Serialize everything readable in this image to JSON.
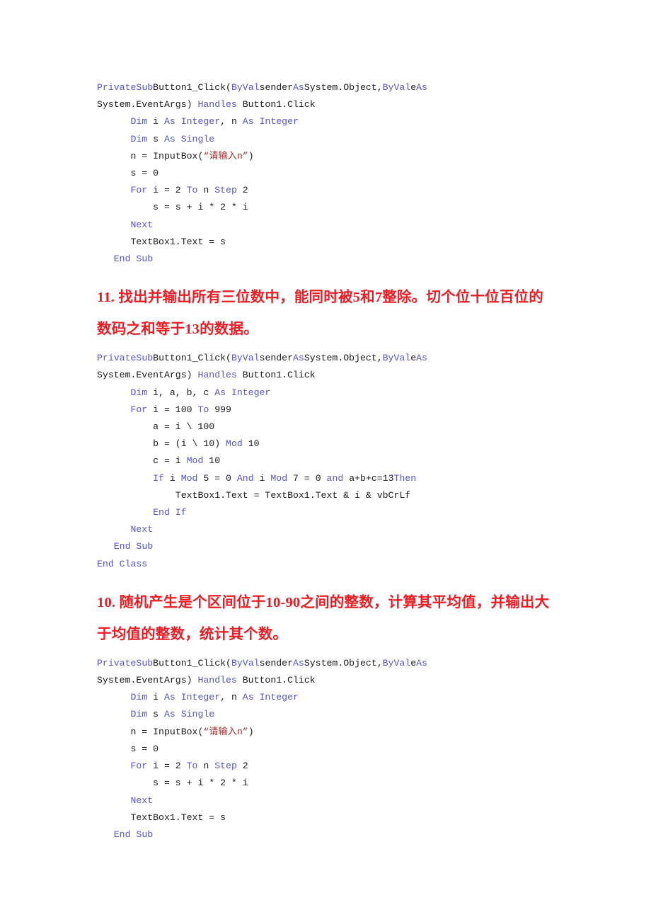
{
  "document": {
    "language": "Visual Basic .NET",
    "page_background": "#ffffff",
    "colors": {
      "keyword": "#5555c8",
      "string": "#a33232",
      "heading": "#ec1c24",
      "body_text": "#1a1a1a"
    }
  },
  "blocks": [
    {
      "type": "code",
      "id": "code-block-1",
      "lines": [
        {
          "justified": true,
          "tokens": [
            {
              "t": "Private",
              "c": "kw"
            },
            {
              "t": "Sub",
              "c": "kw"
            },
            {
              "t": "Button1_Click(",
              "c": "plain"
            },
            {
              "t": "ByVal",
              "c": "kw"
            },
            {
              "t": "sender",
              "c": "plain"
            },
            {
              "t": "As",
              "c": "kw"
            },
            {
              "t": "System.Object,",
              "c": "plain"
            },
            {
              "t": "ByVal",
              "c": "kw"
            },
            {
              "t": "e",
              "c": "plain"
            },
            {
              "t": "As",
              "c": "kw"
            }
          ]
        },
        {
          "justified": false,
          "tokens": [
            {
              "t": "System.EventArgs) ",
              "c": "plain"
            },
            {
              "t": "Handles",
              "c": "kw"
            },
            {
              "t": " Button1.Click",
              "c": "plain"
            }
          ]
        },
        {
          "justified": false,
          "tokens": [
            {
              "t": "      ",
              "c": "plain"
            },
            {
              "t": "Dim",
              "c": "kw"
            },
            {
              "t": " i ",
              "c": "plain"
            },
            {
              "t": "As Integer",
              "c": "kw"
            },
            {
              "t": ", n ",
              "c": "plain"
            },
            {
              "t": "As Integer",
              "c": "kw"
            }
          ]
        },
        {
          "justified": false,
          "tokens": [
            {
              "t": "      ",
              "c": "plain"
            },
            {
              "t": "Dim",
              "c": "kw"
            },
            {
              "t": " s ",
              "c": "plain"
            },
            {
              "t": "As Single",
              "c": "kw"
            }
          ]
        },
        {
          "justified": false,
          "tokens": [
            {
              "t": "      n = InputBox(",
              "c": "plain"
            },
            {
              "t": "“请输入n”",
              "c": "str"
            },
            {
              "t": ")",
              "c": "plain"
            }
          ]
        },
        {
          "justified": false,
          "tokens": [
            {
              "t": "      s = 0",
              "c": "plain"
            }
          ]
        },
        {
          "justified": false,
          "tokens": [
            {
              "t": "      ",
              "c": "plain"
            },
            {
              "t": "For",
              "c": "kw"
            },
            {
              "t": " i = 2 ",
              "c": "plain"
            },
            {
              "t": "To",
              "c": "kw"
            },
            {
              "t": " n ",
              "c": "plain"
            },
            {
              "t": "Step",
              "c": "kw"
            },
            {
              "t": " 2",
              "c": "plain"
            }
          ]
        },
        {
          "justified": false,
          "tokens": [
            {
              "t": "          s = s + i * 2 * i",
              "c": "plain"
            }
          ]
        },
        {
          "justified": false,
          "tokens": [
            {
              "t": "      ",
              "c": "plain"
            },
            {
              "t": "Next",
              "c": "kw"
            }
          ]
        },
        {
          "justified": false,
          "tokens": [
            {
              "t": "      TextBox1.Text = s",
              "c": "plain"
            }
          ]
        },
        {
          "justified": false,
          "tokens": [
            {
              "t": "   ",
              "c": "plain"
            },
            {
              "t": "End Sub",
              "c": "kw"
            }
          ]
        }
      ]
    },
    {
      "type": "heading",
      "id": "heading-11",
      "text": "11. 找出并输出所有三位数中，能同时被5和7整除。切个位十位百位的数码之和等于13的数据。"
    },
    {
      "type": "code",
      "id": "code-block-2",
      "lines": [
        {
          "justified": true,
          "tokens": [
            {
              "t": "Private",
              "c": "kw"
            },
            {
              "t": "Sub",
              "c": "kw"
            },
            {
              "t": "Button1_Click(",
              "c": "plain"
            },
            {
              "t": "ByVal",
              "c": "kw"
            },
            {
              "t": "sender",
              "c": "plain"
            },
            {
              "t": "As",
              "c": "kw"
            },
            {
              "t": "System.Object,",
              "c": "plain"
            },
            {
              "t": "ByVal",
              "c": "kw"
            },
            {
              "t": "e",
              "c": "plain"
            },
            {
              "t": "As",
              "c": "kw"
            }
          ]
        },
        {
          "justified": false,
          "tokens": [
            {
              "t": "System.EventArgs) ",
              "c": "plain"
            },
            {
              "t": "Handles",
              "c": "kw"
            },
            {
              "t": " Button1.Click",
              "c": "plain"
            }
          ]
        },
        {
          "justified": false,
          "tokens": [
            {
              "t": "      ",
              "c": "plain"
            },
            {
              "t": "Dim",
              "c": "kw"
            },
            {
              "t": " i, a, b, c ",
              "c": "plain"
            },
            {
              "t": "As Integer",
              "c": "kw"
            }
          ]
        },
        {
          "justified": false,
          "tokens": [
            {
              "t": "      ",
              "c": "plain"
            },
            {
              "t": "For",
              "c": "kw"
            },
            {
              "t": " i = 100 ",
              "c": "plain"
            },
            {
              "t": "To",
              "c": "kw"
            },
            {
              "t": " 999",
              "c": "plain"
            }
          ]
        },
        {
          "justified": false,
          "tokens": [
            {
              "t": "          a = i \\ 100",
              "c": "plain"
            }
          ]
        },
        {
          "justified": false,
          "tokens": [
            {
              "t": "          b = (i \\ 10) ",
              "c": "plain"
            },
            {
              "t": "Mod",
              "c": "kw"
            },
            {
              "t": " 10",
              "c": "plain"
            }
          ]
        },
        {
          "justified": false,
          "tokens": [
            {
              "t": "          c = i ",
              "c": "plain"
            },
            {
              "t": "Mod",
              "c": "kw"
            },
            {
              "t": " 10",
              "c": "plain"
            }
          ]
        },
        {
          "justified": false,
          "tokens": [
            {
              "t": "          ",
              "c": "plain"
            },
            {
              "t": "If",
              "c": "kw"
            },
            {
              "t": " i ",
              "c": "plain"
            },
            {
              "t": "Mod",
              "c": "kw"
            },
            {
              "t": " 5 = 0 ",
              "c": "plain"
            },
            {
              "t": "And",
              "c": "kw"
            },
            {
              "t": " i ",
              "c": "plain"
            },
            {
              "t": "Mod",
              "c": "kw"
            },
            {
              "t": " 7 = 0 ",
              "c": "plain"
            },
            {
              "t": "and",
              "c": "kw"
            },
            {
              "t": " a+b+c=13",
              "c": "plain"
            },
            {
              "t": "Then",
              "c": "kw"
            }
          ]
        },
        {
          "justified": false,
          "tokens": [
            {
              "t": "              TextBox1.Text = TextBox1.Text & i & vbCrLf",
              "c": "plain"
            }
          ]
        },
        {
          "justified": false,
          "tokens": [
            {
              "t": "          ",
              "c": "plain"
            },
            {
              "t": "End If",
              "c": "kw"
            }
          ]
        },
        {
          "justified": false,
          "tokens": [
            {
              "t": "      ",
              "c": "plain"
            },
            {
              "t": "Next",
              "c": "kw"
            }
          ]
        },
        {
          "justified": false,
          "tokens": [
            {
              "t": "   ",
              "c": "plain"
            },
            {
              "t": "End Sub",
              "c": "kw"
            }
          ]
        },
        {
          "justified": false,
          "tokens": [
            {
              "t": "End Class",
              "c": "kw"
            }
          ]
        }
      ]
    },
    {
      "type": "heading",
      "id": "heading-10",
      "text": "10. 随机产生是个区间位于10-90之间的整数，计算其平均值，并输出大于均值的整数，统计其个数。"
    },
    {
      "type": "code",
      "id": "code-block-3",
      "lines": [
        {
          "justified": true,
          "tokens": [
            {
              "t": "Private",
              "c": "kw"
            },
            {
              "t": "Sub",
              "c": "kw"
            },
            {
              "t": "Button1_Click(",
              "c": "plain"
            },
            {
              "t": "ByVal",
              "c": "kw"
            },
            {
              "t": "sender",
              "c": "plain"
            },
            {
              "t": "As",
              "c": "kw"
            },
            {
              "t": "System.Object,",
              "c": "plain"
            },
            {
              "t": "ByVal",
              "c": "kw"
            },
            {
              "t": "e",
              "c": "plain"
            },
            {
              "t": "As",
              "c": "kw"
            }
          ]
        },
        {
          "justified": false,
          "tokens": [
            {
              "t": "System.EventArgs) ",
              "c": "plain"
            },
            {
              "t": "Handles",
              "c": "kw"
            },
            {
              "t": " Button1.Click",
              "c": "plain"
            }
          ]
        },
        {
          "justified": false,
          "tokens": [
            {
              "t": "      ",
              "c": "plain"
            },
            {
              "t": "Dim",
              "c": "kw"
            },
            {
              "t": " i ",
              "c": "plain"
            },
            {
              "t": "As Integer",
              "c": "kw"
            },
            {
              "t": ", n ",
              "c": "plain"
            },
            {
              "t": "As Integer",
              "c": "kw"
            }
          ]
        },
        {
          "justified": false,
          "tokens": [
            {
              "t": "      ",
              "c": "plain"
            },
            {
              "t": "Dim",
              "c": "kw"
            },
            {
              "t": " s ",
              "c": "plain"
            },
            {
              "t": "As Single",
              "c": "kw"
            }
          ]
        },
        {
          "justified": false,
          "tokens": [
            {
              "t": "      n = InputBox(",
              "c": "plain"
            },
            {
              "t": "“请输入n”",
              "c": "str"
            },
            {
              "t": ")",
              "c": "plain"
            }
          ]
        },
        {
          "justified": false,
          "tokens": [
            {
              "t": "      s = 0",
              "c": "plain"
            }
          ]
        },
        {
          "justified": false,
          "tokens": [
            {
              "t": "      ",
              "c": "plain"
            },
            {
              "t": "For",
              "c": "kw"
            },
            {
              "t": " i = 2 ",
              "c": "plain"
            },
            {
              "t": "To",
              "c": "kw"
            },
            {
              "t": " n ",
              "c": "plain"
            },
            {
              "t": "Step",
              "c": "kw"
            },
            {
              "t": " 2",
              "c": "plain"
            }
          ]
        },
        {
          "justified": false,
          "tokens": [
            {
              "t": "          s = s + i * 2 * i",
              "c": "plain"
            }
          ]
        },
        {
          "justified": false,
          "tokens": [
            {
              "t": "      ",
              "c": "plain"
            },
            {
              "t": "Next",
              "c": "kw"
            }
          ]
        },
        {
          "justified": false,
          "tokens": [
            {
              "t": "      TextBox1.Text = s",
              "c": "plain"
            }
          ]
        },
        {
          "justified": false,
          "tokens": [
            {
              "t": "   ",
              "c": "plain"
            },
            {
              "t": "End Sub",
              "c": "kw"
            }
          ]
        }
      ]
    }
  ]
}
